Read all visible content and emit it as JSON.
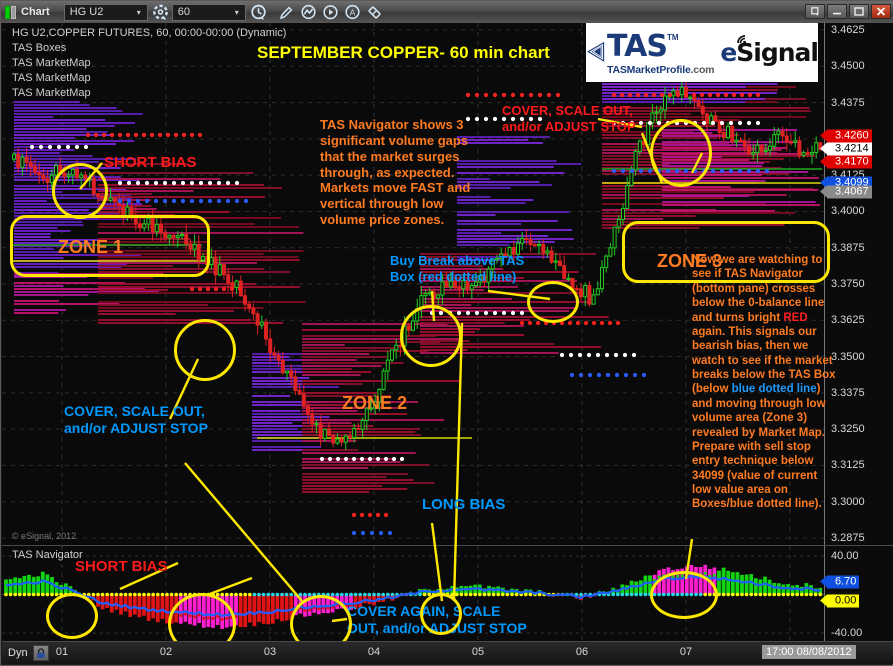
{
  "window": {
    "title": "Chart",
    "controls": [
      "restore-icon",
      "minimize-icon",
      "maximize-icon",
      "close-icon"
    ]
  },
  "toolbar": {
    "symbol": "HG U2",
    "symbol_arrow": "▾",
    "interval": "60",
    "interval_arrow": "▾",
    "buttons": [
      {
        "name": "symbol-settings-icon",
        "label": "gear"
      },
      {
        "name": "time-settings-icon",
        "label": "clock"
      },
      {
        "name": "draw-pencil-icon",
        "label": "pencil"
      },
      {
        "name": "study-icon",
        "label": "study"
      },
      {
        "name": "play-icon",
        "label": "play"
      },
      {
        "name": "annotate-text-icon",
        "label": "A"
      },
      {
        "name": "eraser-icon",
        "label": "eraser"
      }
    ]
  },
  "header": {
    "symbol_line": "HG U2,COPPER FUTURES, 60, 00:00-00:00 (Dynamic)",
    "studies": [
      "TAS Boxes",
      "TAS MarketMap",
      "TAS MarketMap",
      "TAS MarketMap"
    ],
    "copyright": "© eSignal, 2012"
  },
  "title_overlay": "SEPTEMBER COPPER- 60 min chart",
  "logo": {
    "brand": "TAS",
    "tm": "TM",
    "sub": "TASMarketProfile",
    "sub_domain": ".com",
    "partner_e": "e",
    "partner": "Signal"
  },
  "nav_pane": {
    "title": "TAS Navigator"
  },
  "chart_data": {
    "type": "line",
    "title": "SEPTEMBER COPPER- 60 min chart",
    "instrument": "HG U2 COPPER FUTURES",
    "interval": "60 min",
    "session": "00:00-00:00 (Dynamic)",
    "xlabel": "",
    "ylabel": "",
    "grid": true,
    "price_axis": {
      "ticks": [
        "3.4625",
        "3.4500",
        "3.4375",
        "3.4250",
        "3.4125",
        "3.4000",
        "3.3875",
        "3.3750",
        "3.3625",
        "3.3500",
        "3.3375",
        "3.3250",
        "3.3125",
        "3.3000",
        "3.2875"
      ],
      "min": 3.2875,
      "max": 3.4625,
      "step": 0.0125
    },
    "price_markers": [
      {
        "value": "3.4260",
        "color": "#e00000",
        "text": "#ffffff",
        "name": "ask-price-tag"
      },
      {
        "value": "3.4214",
        "color": "#ffffff",
        "text": "#000000",
        "name": "last-price-tag"
      },
      {
        "value": "3.4170",
        "color": "#e00000",
        "text": "#ffffff",
        "name": "bid-price-tag"
      },
      {
        "value": "3.4099",
        "color": "#1050e0",
        "text": "#ffffff",
        "name": "tas-box-low-tag"
      },
      {
        "value": "3.4067",
        "color": "#8a8a8a",
        "text": "#ffffff",
        "name": "value-area-tag"
      }
    ],
    "navigator_axis": {
      "ticks": [
        "40.00",
        "-40.00"
      ],
      "min": -40,
      "max": 40,
      "zero_line": 0
    },
    "navigator_markers": [
      {
        "value": "6.70",
        "color": "#1050e0",
        "text": "#ffffff",
        "name": "navigator-value-tag"
      },
      {
        "value": "0.00",
        "color": "#ffff00",
        "text": "#000000",
        "name": "navigator-zero-tag"
      }
    ],
    "time_axis": {
      "ticks": [
        "01",
        "02",
        "03",
        "04",
        "05",
        "06",
        "07",
        "08"
      ],
      "current": "17:00 08/08/2012"
    }
  },
  "annotations": [
    {
      "name": "annotation-short-bias-top",
      "text": "SHORT BIAS",
      "color": "red"
    },
    {
      "name": "annotation-zone-1",
      "text": "ZONE 1",
      "color": "orange"
    },
    {
      "name": "annotation-zone-2",
      "text": "ZONE 2",
      "color": "orange"
    },
    {
      "name": "annotation-zone-3",
      "text": "ZONE 3",
      "color": "orange"
    },
    {
      "name": "annotation-navigator-gaps",
      "text": "TAS Navigator shows 3\nsignificant volume gaps\nthat the market surges\nthrough, as expected.\nMarkets move FAST and\nvertical through low\nvolume price zones.",
      "color": "orange"
    },
    {
      "name": "annotation-cover-scale-out-top",
      "text": "COVER, SCALE OUT,\nand/or ADJUST STOP",
      "color": "red"
    },
    {
      "name": "annotation-buy-break",
      "text": "Buy Break above TAS\nBox (red dotted line)",
      "color": "cyan"
    },
    {
      "name": "annotation-cover-scale-out-left",
      "text": "COVER, SCALE OUT,\nand/or ADJUST STOP",
      "color": "cyan"
    },
    {
      "name": "annotation-long-bias",
      "text": "LONG BIAS",
      "color": "cyan"
    },
    {
      "name": "annotation-short-bias-nav",
      "text": "SHORT BIAS",
      "color": "red"
    },
    {
      "name": "annotation-cover-again",
      "text": "COVER AGAIN, SCALE\nOUT, and/or ADJUST STOP",
      "color": "cyan"
    }
  ],
  "annotation_outlook": {
    "name": "annotation-bearish-outlook",
    "p1": "Now we are watching to see if TAS Navigator (bottom pane) crosses below the 0-balance line and turns bright ",
    "red_word": "RED",
    "p2": " again. This signals our bearish bias, then we watch to see if the market breaks below the TAS Box (below ",
    "blue_word": "blue dotted line",
    "p3": ") and moving through low volume area (Zone 3) revealed by Market Map. Prepare with sell stop entry technique below 34099 (value of current low value area on Boxes/blue dotted line)."
  },
  "statusbar": {
    "mode": "Dyn",
    "lock_icon": "lock-icon"
  },
  "colors": {
    "annotation_red": "#ff1a1a",
    "annotation_cyan": "#0099ff",
    "annotation_orange": "#ff7b21",
    "highlight_yellow": "#ffff00",
    "background": "#0b0b0b"
  }
}
